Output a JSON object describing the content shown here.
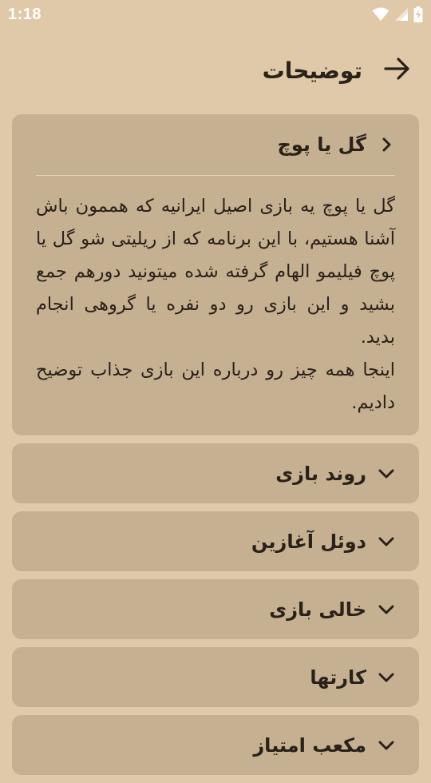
{
  "status_bar": {
    "time": "1:18",
    "icons": [
      "wifi-icon",
      "signal-icon",
      "battery-charging-icon"
    ]
  },
  "header": {
    "title": "توضیحات",
    "back_icon": "arrow-back-icon"
  },
  "sections": [
    {
      "title": "گل یا پوچ",
      "expanded": true,
      "body": [
        "گل یا پوچ یه بازی اصیل ایرانیه که هممون باش آشنا هستیم، با این برنامه که از ریلیتی شو گل یا پوچ فیلیمو الهام گرفته شده میتونید دورهم جمع بشید و این بازی رو دو نفره یا گروهی انجام بدید.",
        "اینجا همه چیز رو درباره این بازی جذاب توضیح دادیم."
      ]
    },
    {
      "title": "روند بازی",
      "expanded": false
    },
    {
      "title": "دوئل آغازین",
      "expanded": false
    },
    {
      "title": "خالی بازی",
      "expanded": false
    },
    {
      "title": "کارتها",
      "expanded": false
    },
    {
      "title": "مکعب امتیاز",
      "expanded": false
    }
  ],
  "colors": {
    "background": "#dfc9a8",
    "card": "#c6b092",
    "text": "#2a2118"
  }
}
